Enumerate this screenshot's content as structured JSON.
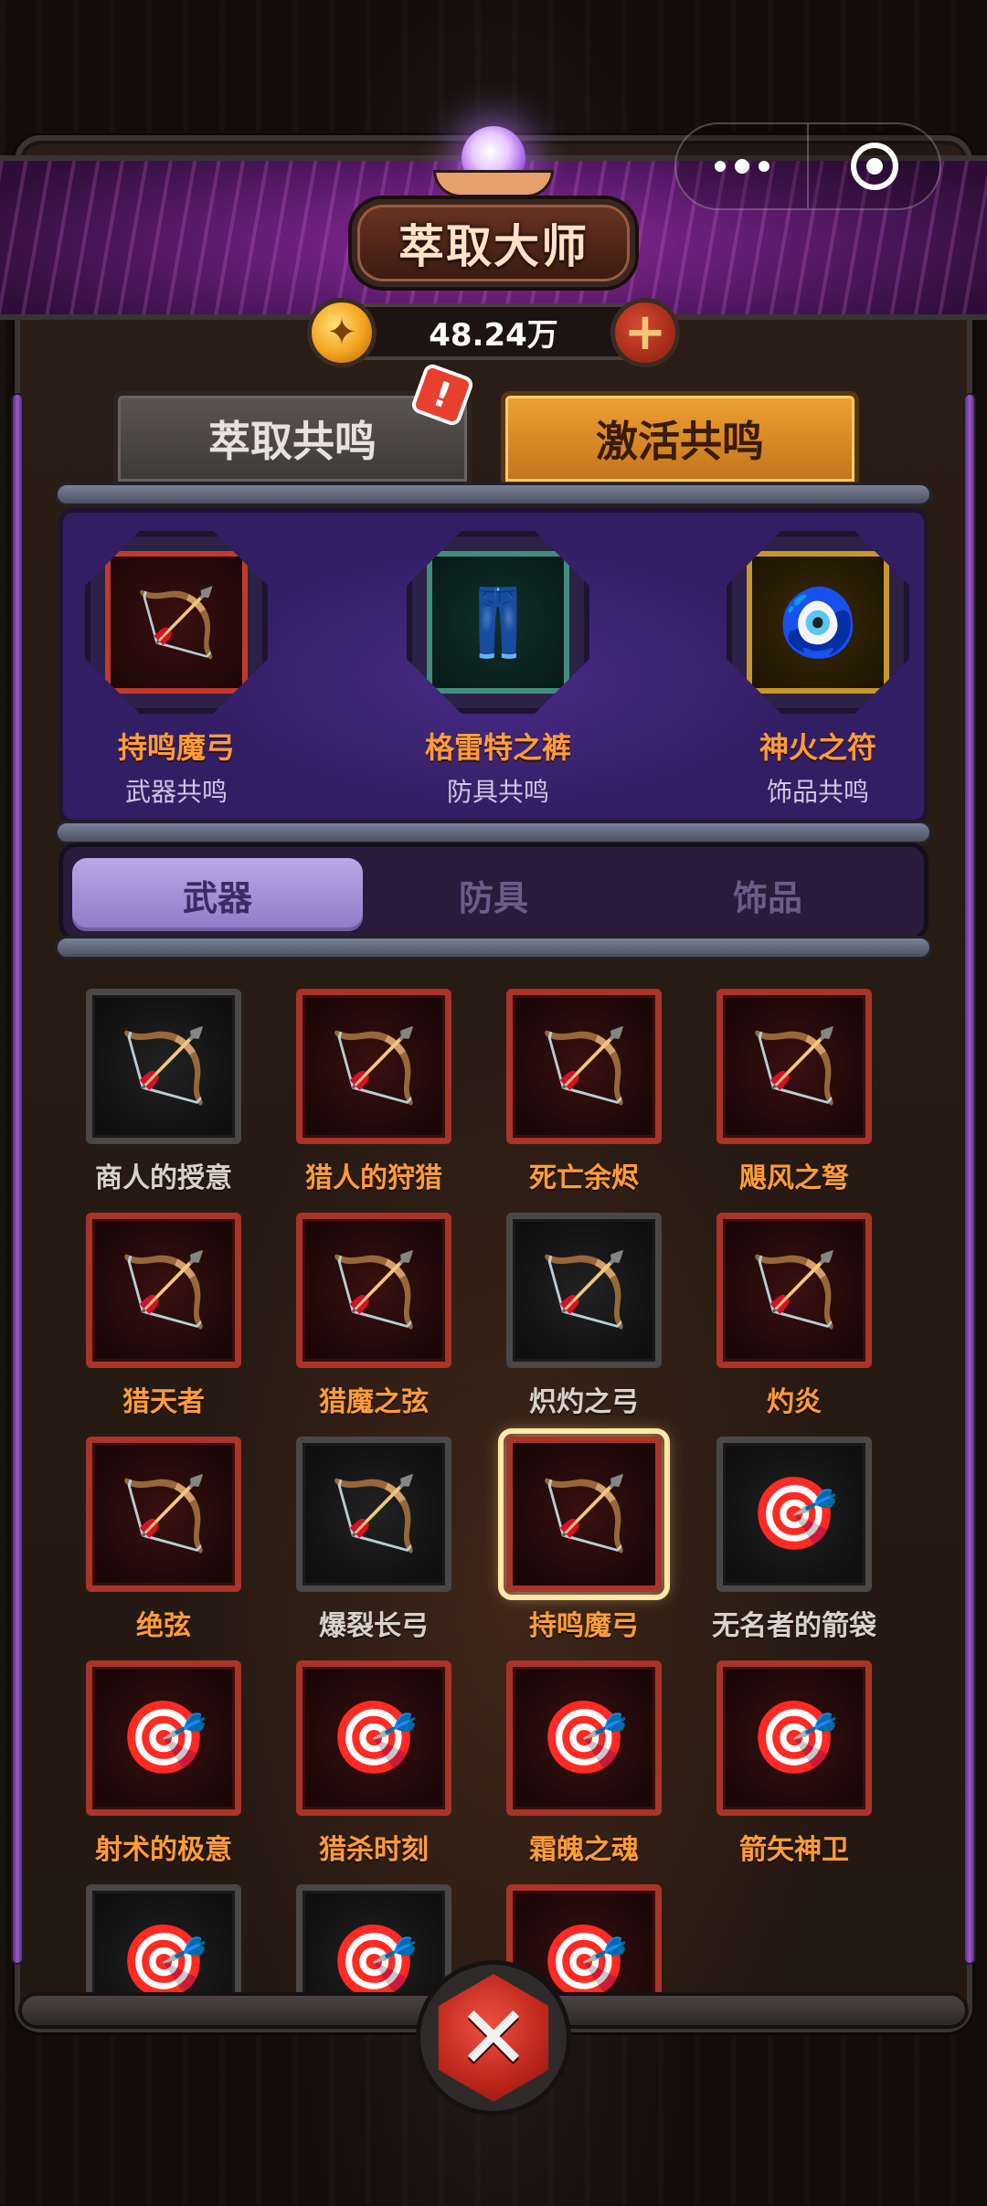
{
  "header": {
    "title": "萃取大师"
  },
  "currency": {
    "amount": "48.24万",
    "add_icon": "plus-icon",
    "coin_icon": "gold-coin-icon"
  },
  "main_tabs": [
    {
      "label": "萃取共鸣",
      "active": false,
      "has_alert": true
    },
    {
      "label": "激活共鸣",
      "active": true
    }
  ],
  "alert_badge": "!",
  "resonance": [
    {
      "name": "持鸣魔弓",
      "type": "武器共鸣",
      "frame_color": "#c0392b",
      "icon": "bow-icon"
    },
    {
      "name": "格雷特之裤",
      "type": "防具共鸣",
      "frame_color": "#3f8e7f",
      "icon": "pants-icon"
    },
    {
      "name": "神火之符",
      "type": "饰品共鸣",
      "frame_color": "#c8962b",
      "icon": "amulet-icon"
    }
  ],
  "categories": [
    {
      "label": "武器",
      "active": true
    },
    {
      "label": "防具",
      "active": false
    },
    {
      "label": "饰品",
      "active": false
    }
  ],
  "items": [
    {
      "name": "商人的授意",
      "rarity": "gray",
      "icon": "crossbow-icon"
    },
    {
      "name": "猎人的狩猎",
      "rarity": "red",
      "icon": "crossbow-icon"
    },
    {
      "name": "死亡余烬",
      "rarity": "red",
      "icon": "bow-icon"
    },
    {
      "name": "飓风之弩",
      "rarity": "red",
      "icon": "crossbow-icon"
    },
    {
      "name": "猎天者",
      "rarity": "red",
      "icon": "bow-icon"
    },
    {
      "name": "猎魔之弦",
      "rarity": "red",
      "icon": "crossbow-icon"
    },
    {
      "name": "炽灼之弓",
      "rarity": "gray",
      "icon": "bow-icon"
    },
    {
      "name": "灼炎",
      "rarity": "red",
      "icon": "crossbow-icon"
    },
    {
      "name": "绝弦",
      "rarity": "red",
      "icon": "bow-icon"
    },
    {
      "name": "爆裂长弓",
      "rarity": "gray",
      "icon": "crossbow-icon"
    },
    {
      "name": "持鸣魔弓",
      "rarity": "red",
      "icon": "bow-icon",
      "selected": true
    },
    {
      "name": "无名者的箭袋",
      "rarity": "gray",
      "icon": "quiver-icon"
    },
    {
      "name": "射术的极意",
      "rarity": "red",
      "icon": "quiver-icon"
    },
    {
      "name": "猎杀时刻",
      "rarity": "red",
      "icon": "quiver-icon"
    },
    {
      "name": "霜魄之魂",
      "rarity": "red",
      "icon": "quiver-icon"
    },
    {
      "name": "箭矢神卫",
      "rarity": "red",
      "icon": "quiver-icon"
    },
    {
      "name": "",
      "rarity": "gray",
      "icon": "quiver-icon"
    },
    {
      "name": "",
      "rarity": "gray",
      "icon": "quiver-icon"
    },
    {
      "name": "",
      "rarity": "red",
      "icon": "quiver-icon"
    }
  ],
  "colors": {
    "accent_orange": "#ff9c3a",
    "active_tab": "#f0a134",
    "panel_purple": "#4a2b86",
    "rare_red": "#a8342a"
  },
  "close_icon": "close-icon"
}
